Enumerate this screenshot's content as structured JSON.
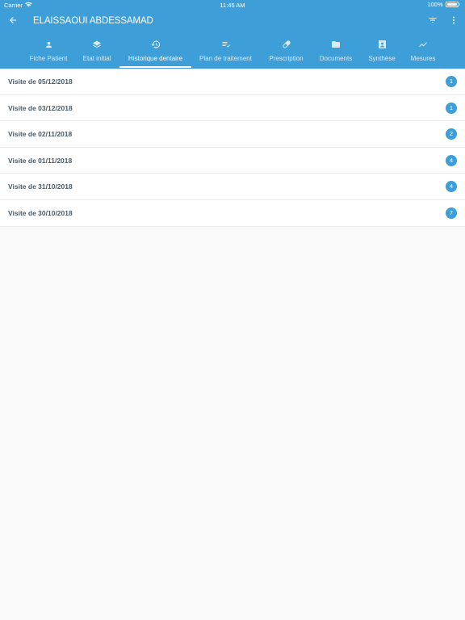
{
  "statusbar": {
    "carrier": "Carrier",
    "time": "11:45 AM",
    "battery": "100%",
    "battery_level": 1.0
  },
  "header": {
    "title": "ELAISSAOUI ABDESSAMAD"
  },
  "icons": {
    "back": "arrow-left-icon",
    "filter": "filter-icon",
    "more": "more-vertical-icon"
  },
  "tabs": [
    {
      "label": "Fiche Patient",
      "icon": "person-icon"
    },
    {
      "label": "Etat initial",
      "icon": "layers-icon"
    },
    {
      "label": "Historique dentaire",
      "icon": "history-icon",
      "active": true
    },
    {
      "label": "Plan de traitement",
      "icon": "playlist-check-icon"
    },
    {
      "label": "Prescription",
      "icon": "pill-icon"
    },
    {
      "label": "Documents",
      "icon": "folder-icon"
    },
    {
      "label": "Synthèse",
      "icon": "contact-card-icon"
    },
    {
      "label": "Mesures",
      "icon": "trending-up-icon"
    }
  ],
  "visits": [
    {
      "label": "Visite de 05/12/2018",
      "count": "1"
    },
    {
      "label": "Visite de 03/12/2018",
      "count": "1"
    },
    {
      "label": "Visite de 02/11/2018",
      "count": "2"
    },
    {
      "label": "Visite de 01/11/2018",
      "count": "4"
    },
    {
      "label": "Visite de 31/10/2018",
      "count": "4"
    },
    {
      "label": "Visite de 30/10/2018",
      "count": "7"
    }
  ],
  "colors": {
    "primary": "#3e9ed8",
    "background": "#f9f9fa",
    "row_text": "#4a5a66"
  }
}
